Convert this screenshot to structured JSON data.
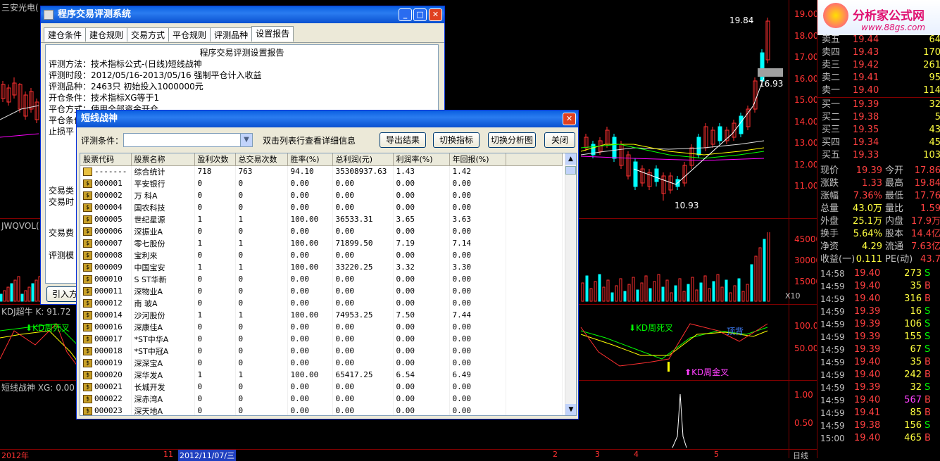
{
  "stock_title": "三安光电(",
  "main_win": {
    "title": "程序交易评测系统",
    "tabs": [
      "建仓条件",
      "建仓规则",
      "交易方式",
      "平仓规则",
      "评测品种",
      "设置报告"
    ],
    "report_title": "程序交易评测设置报告",
    "lines": [
      "评测方法：技术指标公式-(日线)短线战神",
      "评测时段：2012/05/16-2013/05/16 强制平仓计入收益",
      "评测品种：2463只 初始投入1000000元",
      "开仓条件：技术指标XG等于1",
      "平仓方式：使用全部资金开仓",
      "平仓条件",
      "止损平"
    ],
    "side_labels": [
      "交易类",
      "交易时",
      "交易费",
      "评测模"
    ],
    "import_btn": "引入方"
  },
  "sub_win": {
    "title": "短线战神",
    "cond_label": "评测条件：",
    "hint": "双击列表行查看详细信息",
    "buttons": [
      "导出结果",
      "切换指标",
      "切换分析图",
      "关闭"
    ],
    "columns": [
      "股票代码",
      "股票名称",
      "盈利次数",
      "总交易次数",
      "胜率(%)",
      "总利润(元)",
      "利润率(%)",
      "年回报(%)"
    ],
    "rows": [
      [
        "-------",
        "综合统计",
        "718",
        "763",
        "94.10",
        "35308937.63",
        "1.43",
        "1.42"
      ],
      [
        "000001",
        "平安银行",
        "0",
        "0",
        "0.00",
        "0.00",
        "0.00",
        "0.00"
      ],
      [
        "000002",
        "万  科A",
        "0",
        "0",
        "0.00",
        "0.00",
        "0.00",
        "0.00"
      ],
      [
        "000004",
        "国农科技",
        "0",
        "0",
        "0.00",
        "0.00",
        "0.00",
        "0.00"
      ],
      [
        "000005",
        "世纪星源",
        "1",
        "1",
        "100.00",
        "36533.31",
        "3.65",
        "3.63"
      ],
      [
        "000006",
        "深振业A",
        "0",
        "0",
        "0.00",
        "0.00",
        "0.00",
        "0.00"
      ],
      [
        "000007",
        "零七股份",
        "1",
        "1",
        "100.00",
        "71899.50",
        "7.19",
        "7.14"
      ],
      [
        "000008",
        "宝利来",
        "0",
        "0",
        "0.00",
        "0.00",
        "0.00",
        "0.00"
      ],
      [
        "000009",
        "中国宝安",
        "1",
        "1",
        "100.00",
        "33220.25",
        "3.32",
        "3.30"
      ],
      [
        "000010",
        "S ST华新",
        "0",
        "0",
        "0.00",
        "0.00",
        "0.00",
        "0.00"
      ],
      [
        "000011",
        "深物业A",
        "0",
        "0",
        "0.00",
        "0.00",
        "0.00",
        "0.00"
      ],
      [
        "000012",
        "南  玻A",
        "0",
        "0",
        "0.00",
        "0.00",
        "0.00",
        "0.00"
      ],
      [
        "000014",
        "沙河股份",
        "1",
        "1",
        "100.00",
        "74953.25",
        "7.50",
        "7.44"
      ],
      [
        "000016",
        "深康佳A",
        "0",
        "0",
        "0.00",
        "0.00",
        "0.00",
        "0.00"
      ],
      [
        "000017",
        "*ST中华A",
        "0",
        "0",
        "0.00",
        "0.00",
        "0.00",
        "0.00"
      ],
      [
        "000018",
        "*ST中冠A",
        "0",
        "0",
        "0.00",
        "0.00",
        "0.00",
        "0.00"
      ],
      [
        "000019",
        "深深宝A",
        "0",
        "0",
        "0.00",
        "0.00",
        "0.00",
        "0.00"
      ],
      [
        "000020",
        "深华发A",
        "1",
        "1",
        "100.00",
        "65417.25",
        "6.54",
        "6.49"
      ],
      [
        "000021",
        "长城开发",
        "0",
        "0",
        "0.00",
        "0.00",
        "0.00",
        "0.00"
      ],
      [
        "000022",
        "深赤湾A",
        "0",
        "0",
        "0.00",
        "0.00",
        "0.00",
        "0.00"
      ],
      [
        "000023",
        "深天地A",
        "0",
        "0",
        "0.00",
        "0.00",
        "0.00",
        "0.00"
      ]
    ]
  },
  "chart": {
    "price_labels": [
      "19.00",
      "18.00",
      "17.00",
      "16.00",
      "15.00",
      "14.00",
      "13.00",
      "12.00",
      "11.00"
    ],
    "vol_labels": [
      "45000",
      "30000",
      "15000"
    ],
    "kd_labels": [
      "100.0",
      "50.00"
    ],
    "xg_labels": [
      "1.00",
      "0.50"
    ],
    "high_label": "19.84",
    "low_label": "10.93",
    "cur_label": "16.93",
    "vol_title": "JWQVOL(",
    "vol_unit": "X10",
    "kd_title": "KDJ超牛 K: 91.72",
    "kd_dead": "KD周死叉",
    "kd_dead2": "KD周死叉",
    "kd_top": "顶背",
    "kd_gold": "KD周金叉",
    "xg_title": "短线战神 XG: 0.00",
    "date_left": "2012年",
    "date_11": "11",
    "date_sel": "2012/11/07/三",
    "date_marks": [
      "2",
      "3",
      "4",
      "5"
    ],
    "period": "日线"
  },
  "logo": {
    "name": "分析家公式网",
    "url": "www.88gs.com"
  },
  "quote": {
    "sell": [
      [
        "卖五",
        "19.44",
        "64"
      ],
      [
        "卖四",
        "19.43",
        "170"
      ],
      [
        "卖三",
        "19.42",
        "261"
      ],
      [
        "卖二",
        "19.41",
        "95"
      ],
      [
        "卖一",
        "19.40",
        "114"
      ]
    ],
    "buy": [
      [
        "买一",
        "19.39",
        "32"
      ],
      [
        "买二",
        "19.38",
        "5"
      ],
      [
        "买三",
        "19.35",
        "43"
      ],
      [
        "买四",
        "19.34",
        "45"
      ],
      [
        "买五",
        "19.33",
        "103"
      ]
    ],
    "stats": [
      [
        "现价",
        "19.39",
        "今开",
        "17.86"
      ],
      [
        "涨跌",
        "1.33",
        "最高",
        "19.84"
      ],
      [
        "涨幅",
        "7.36%",
        "最低",
        "17.76"
      ],
      [
        "总量",
        "43.0万",
        "量比",
        "1.59"
      ],
      [
        "外盘",
        "25.1万",
        "内盘",
        "17.9万"
      ],
      [
        "换手",
        "5.64%",
        "股本",
        "14.4亿"
      ],
      [
        "净资",
        "4.29",
        "流通",
        "7.63亿"
      ],
      [
        "收益(一)",
        "0.111",
        "PE(动)",
        "43.7"
      ]
    ],
    "ticks": [
      [
        "14:58",
        "19.40",
        "273",
        "S"
      ],
      [
        "14:59",
        "19.40",
        "35",
        "B"
      ],
      [
        "14:59",
        "19.40",
        "316",
        "B"
      ],
      [
        "14:59",
        "19.39",
        "16",
        "S"
      ],
      [
        "14:59",
        "19.39",
        "106",
        "S"
      ],
      [
        "14:59",
        "19.39",
        "155",
        "S"
      ],
      [
        "14:59",
        "19.39",
        "67",
        "S"
      ],
      [
        "14:59",
        "19.40",
        "35",
        "B"
      ],
      [
        "14:59",
        "19.40",
        "242",
        "B"
      ],
      [
        "14:59",
        "19.39",
        "32",
        "S"
      ],
      [
        "14:59",
        "19.40",
        "567",
        "B"
      ],
      [
        "14:59",
        "19.41",
        "85",
        "B"
      ],
      [
        "14:59",
        "19.38",
        "156",
        "S"
      ],
      [
        "15:00",
        "19.40",
        "465",
        "B"
      ]
    ]
  }
}
